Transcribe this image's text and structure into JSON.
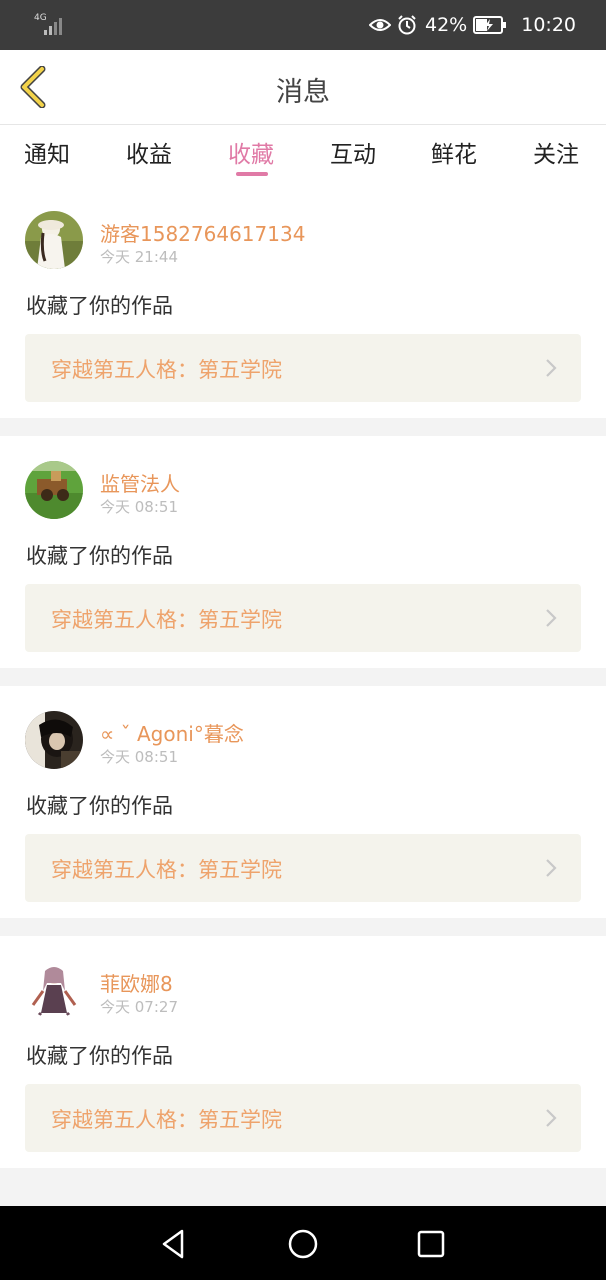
{
  "status_bar": {
    "network": "4G",
    "battery_percent": "42%",
    "time": "10:20",
    "icons": [
      "signal-icon",
      "eye-icon",
      "alarm-icon",
      "battery-charging-icon"
    ]
  },
  "header": {
    "title": "消息",
    "back_icon": "chevron-left-icon"
  },
  "tabs": [
    {
      "label": "通知",
      "active": false
    },
    {
      "label": "收益",
      "active": false
    },
    {
      "label": "收藏",
      "active": true
    },
    {
      "label": "互动",
      "active": false
    },
    {
      "label": "鲜花",
      "active": false
    },
    {
      "label": "关注",
      "active": false
    }
  ],
  "messages": [
    {
      "username": "游客1582764617134",
      "time": "今天 21:44",
      "action": "收藏了你的作品",
      "work_title": "穿越第五人格：第五学院"
    },
    {
      "username": "监管法人",
      "time": "今天 08:51",
      "action": "收藏了你的作品",
      "work_title": "穿越第五人格：第五学院"
    },
    {
      "username": "∝ ˇ Agoni°暮念",
      "time": "今天 08:51",
      "action": "收藏了你的作品",
      "work_title": "穿越第五人格：第五学院"
    },
    {
      "username": "菲欧娜8",
      "time": "今天 07:27",
      "action": "收藏了你的作品",
      "work_title": "穿越第五人格：第五学院"
    }
  ],
  "nav_bar": {
    "icons": [
      "back-triangle-icon",
      "home-circle-icon",
      "recents-square-icon"
    ]
  },
  "colors": {
    "accent": "#e07aa6",
    "username": "#e8965a",
    "work_title": "#eea36c",
    "work_box_bg": "#f4f3ec",
    "back_arrow": "#f3d34a"
  }
}
